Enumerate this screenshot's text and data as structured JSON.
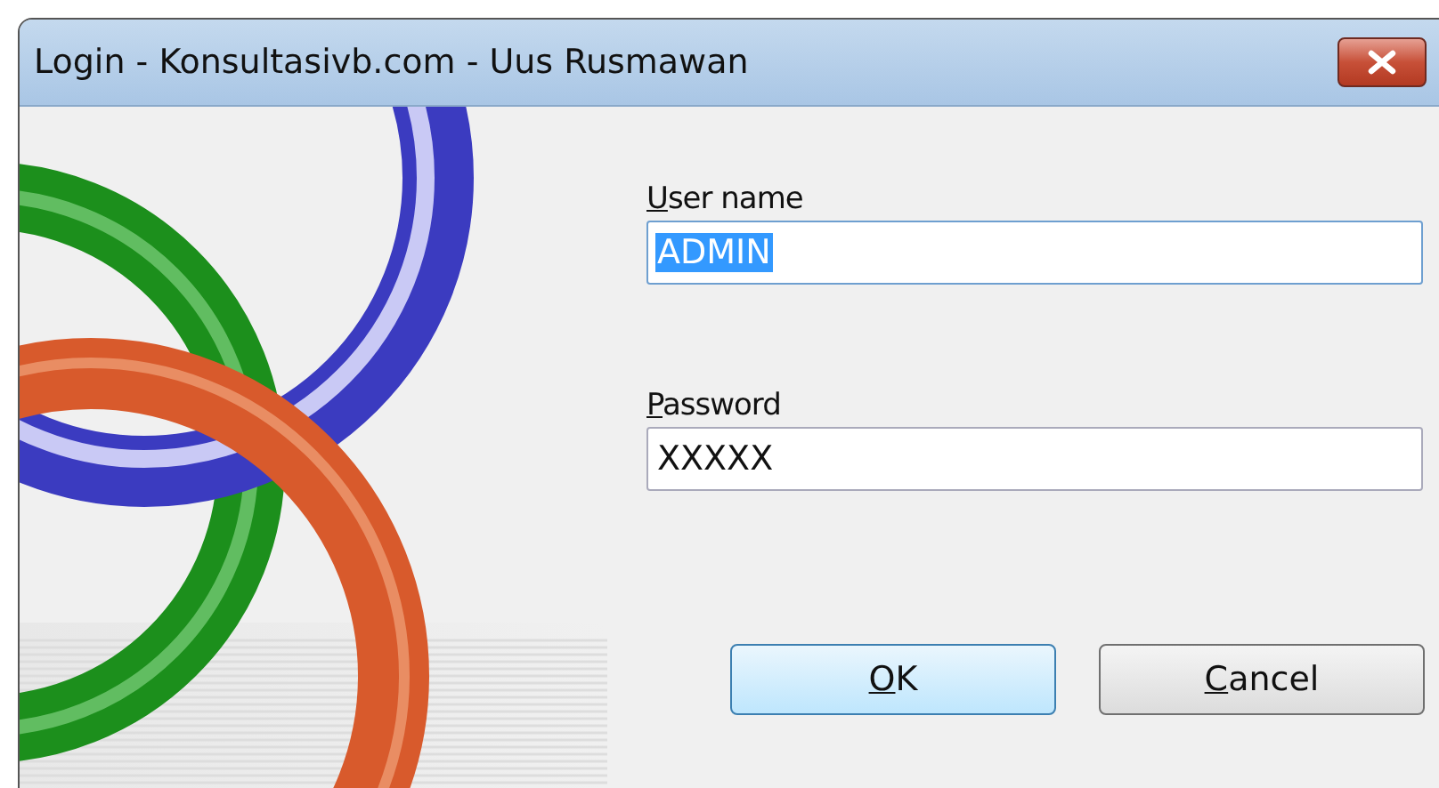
{
  "window": {
    "title": "Login - Konsultasivb.com - Uus Rusmawan"
  },
  "fields": [
    {
      "label": "User name",
      "first_letter_underlined": true,
      "value": "ADMIN",
      "selected": true
    },
    {
      "label": "Password",
      "first_letter_underlined": true,
      "value": "XXXXX",
      "selected": false
    }
  ],
  "buttons": [
    {
      "label": "OK",
      "first_letter_underlined": true,
      "default": true
    },
    {
      "label": "Cancel",
      "first_letter_underlined": true,
      "default": false
    }
  ]
}
